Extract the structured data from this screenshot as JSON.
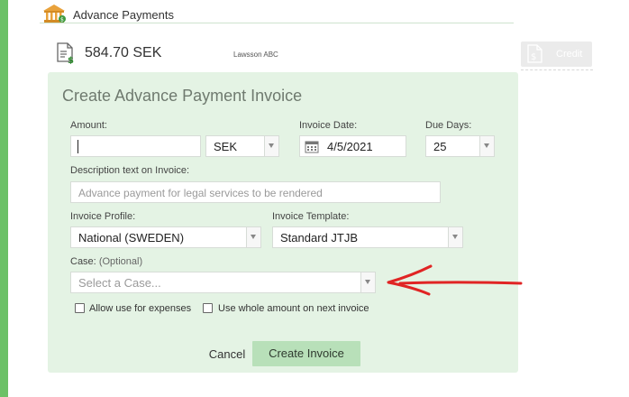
{
  "header": {
    "title": "Advance Payments",
    "icon": "bank-icon"
  },
  "balance": {
    "amount": "584.70 SEK",
    "client": "Lawsson ABC",
    "icon": "invoice-document-icon"
  },
  "credit_button": {
    "label": "Credit",
    "icon": "credit-document-icon"
  },
  "form": {
    "title": "Create Advance Payment Invoice",
    "amount": {
      "label": "Amount:",
      "value": ""
    },
    "currency": {
      "value": "SEK"
    },
    "invoice_date": {
      "label": "Invoice Date:",
      "value": "4/5/2021"
    },
    "due_days": {
      "label": "Due Days:",
      "value": "25"
    },
    "description": {
      "label": "Description text on Invoice:",
      "placeholder": "Advance payment for legal services to be rendered"
    },
    "invoice_profile": {
      "label": "Invoice Profile:",
      "value": "National (SWEDEN)"
    },
    "invoice_template": {
      "label": "Invoice Template:",
      "value": "Standard JTJB"
    },
    "case": {
      "label": "Case:",
      "optional": "(Optional)",
      "placeholder": "Select a Case..."
    },
    "allow_expenses": {
      "label": "Allow use for expenses",
      "checked": false
    },
    "use_whole_amount": {
      "label": "Use whole amount on next invoice",
      "checked": false
    },
    "cancel_label": "Cancel",
    "create_label": "Create Invoice"
  },
  "colors": {
    "accent_green": "#6cc167",
    "panel_bg": "#e4f3e4",
    "create_button_bg": "#b8e0b9",
    "annotation_arrow": "#e02424"
  }
}
